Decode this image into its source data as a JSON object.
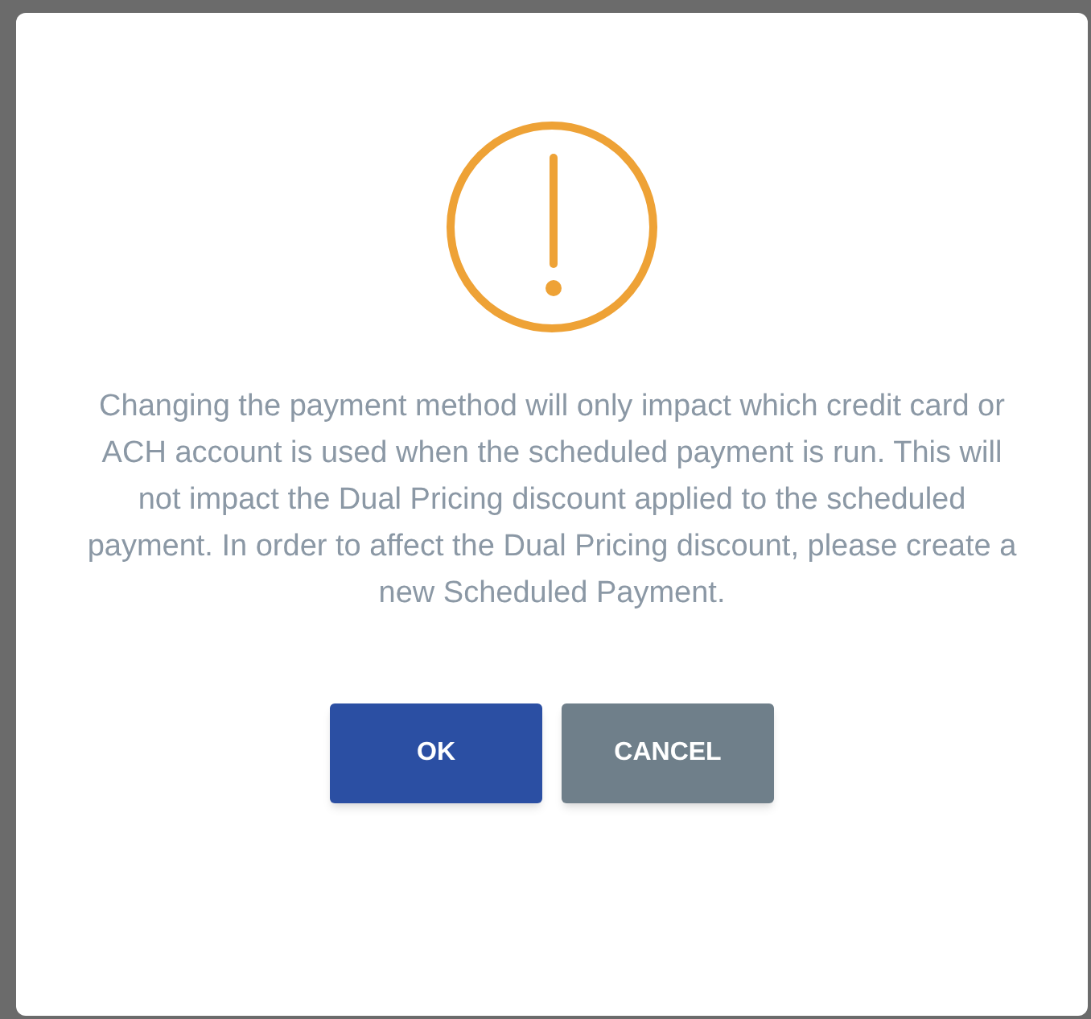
{
  "dialog": {
    "message": "Changing the payment method will only impact which credit card or ACH account is used when the scheduled payment is run. This will not impact the Dual Pricing discount applied to the scheduled payment. In order to affect the Dual Pricing discount, please create a new Scheduled Payment.",
    "buttons": [
      {
        "label": "OK",
        "kind": "primary"
      },
      {
        "label": "CANCEL",
        "kind": "secondary"
      }
    ]
  }
}
